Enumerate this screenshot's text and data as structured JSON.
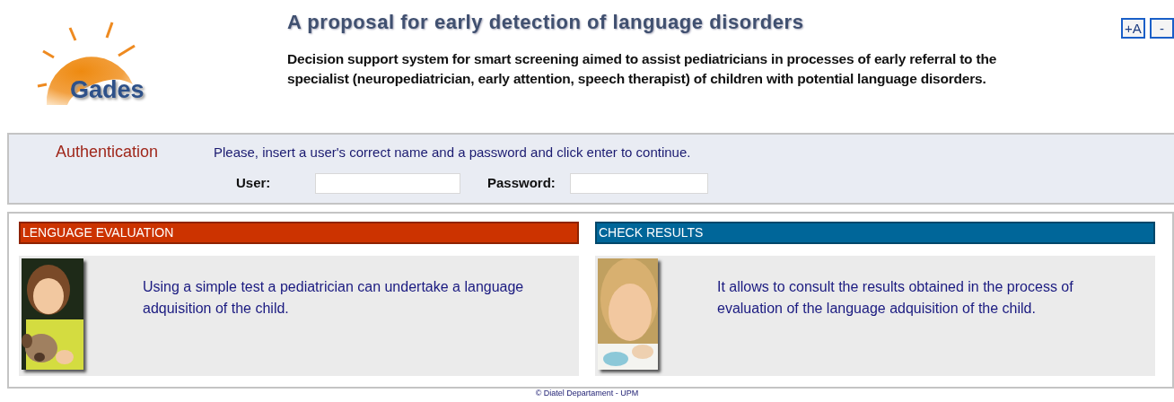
{
  "logo": {
    "text": "Gades"
  },
  "header": {
    "title": "A proposal for early detection of language disorders",
    "description": "Decision support system for smart screening aimed to assist pediatricians in processes of early referral to the specialist (neuropediatrician, early attention, speech therapist) of children with potential language disorders."
  },
  "font_buttons": [
    "+A",
    "-"
  ],
  "authentication": {
    "title": "Authentication",
    "instructions": "Please, insert a user's correct name and a password and click enter to continue.",
    "fields": [
      {
        "label": "User:"
      },
      {
        "label": "Password:"
      }
    ]
  },
  "sections": [
    {
      "title": "LENGUAGE EVALUATION",
      "color": "#cc3300",
      "description": "Using a simple test a pediatrician can undertake a language adquisition of the child."
    },
    {
      "title": "CHECK RESULTS",
      "color": "#006699",
      "description": "It allows to consult the results obtained in the process of evaluation of the language adquisition of the child."
    }
  ],
  "footer": "© Diatel Departament - UPM"
}
